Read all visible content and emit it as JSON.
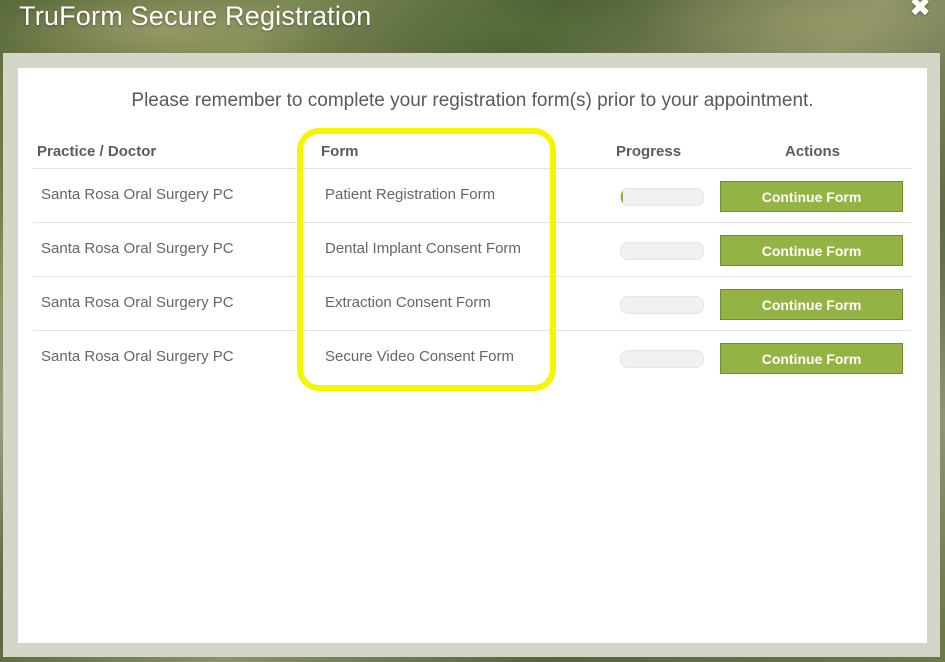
{
  "window": {
    "title": "TruForm Secure Registration",
    "close_icon": "close-icon",
    "close_glyph": "✖"
  },
  "notice": "Please remember to complete your registration form(s) prior to your appointment.",
  "table": {
    "headers": {
      "practice": "Practice / Doctor",
      "form": "Form",
      "progress": "Progress",
      "actions": "Actions"
    },
    "rows": [
      {
        "practice": "Santa Rosa Oral Surgery PC",
        "form": "Patient Registration Form",
        "progress": 0.02,
        "action_label": "Continue Form"
      },
      {
        "practice": "Santa Rosa Oral Surgery PC",
        "form": "Dental Implant Consent Form",
        "progress": 0,
        "action_label": "Continue Form"
      },
      {
        "practice": "Santa Rosa Oral Surgery PC",
        "form": "Extraction Consent Form",
        "progress": 0,
        "action_label": "Continue Form"
      },
      {
        "practice": "Santa Rosa Oral Surgery PC",
        "form": "Secure Video Consent Form",
        "progress": 0,
        "action_label": "Continue Form"
      }
    ]
  },
  "colors": {
    "button": "#93b445",
    "progress_fill": "#8cb03a",
    "highlight": "#f5f500"
  }
}
